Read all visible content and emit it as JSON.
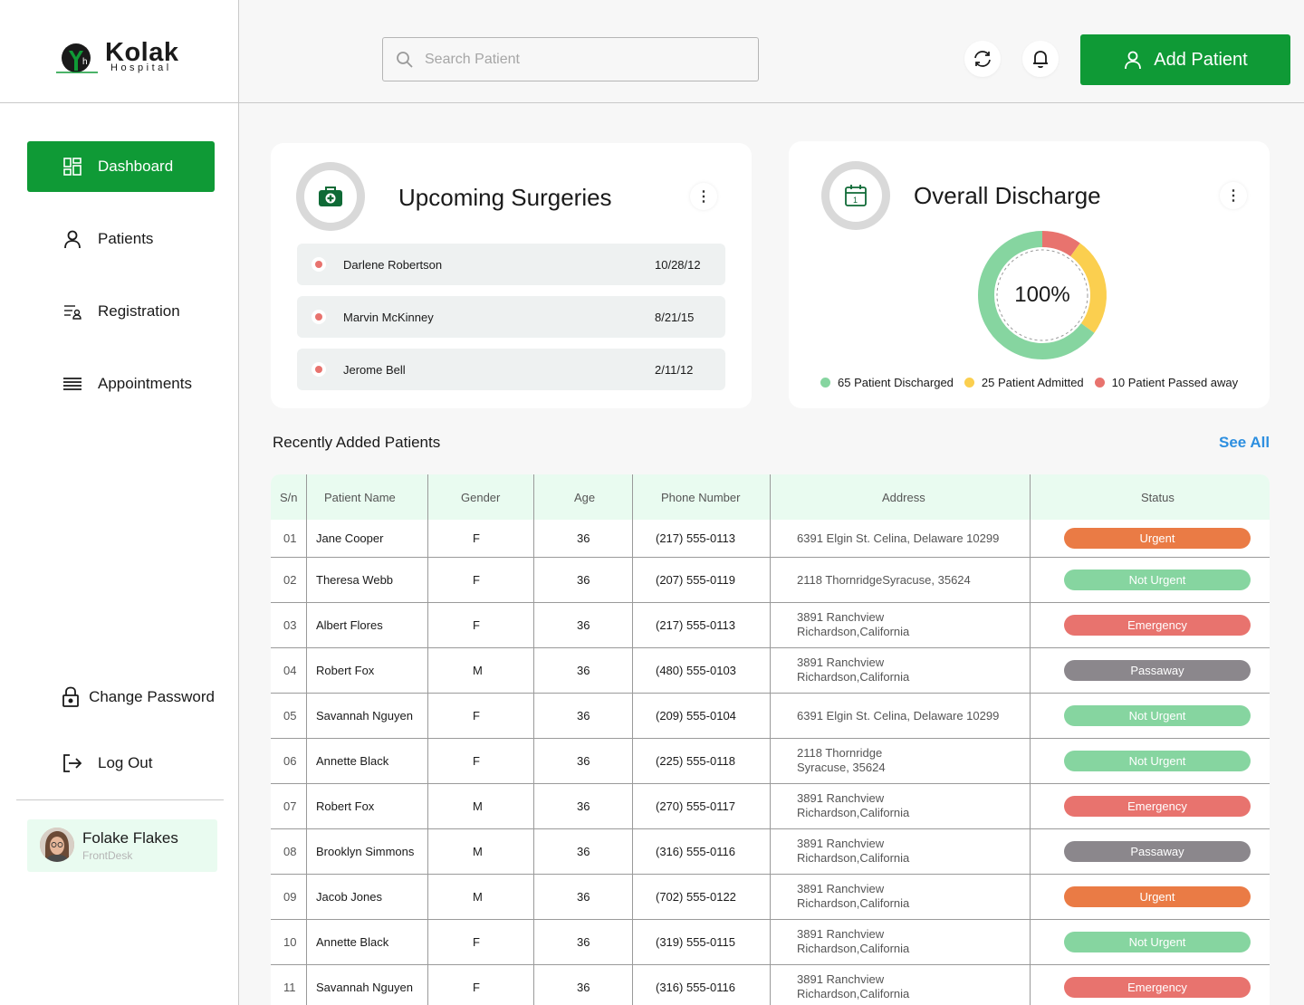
{
  "brand": {
    "name": "Kolak",
    "subtitle": "Hospital"
  },
  "header": {
    "search_placeholder": "Search Patient",
    "add_patient_label": "Add Patient"
  },
  "sidebar": {
    "items": [
      {
        "label": "Dashboard",
        "active": true
      },
      {
        "label": "Patients"
      },
      {
        "label": "Registration"
      },
      {
        "label": "Appointments"
      }
    ],
    "bottom_items": [
      {
        "label": "Change Password"
      },
      {
        "label": "Log Out"
      }
    ],
    "user": {
      "name": "Folake Flakes",
      "role": "FrontDesk"
    }
  },
  "surgeries": {
    "title": "Upcoming Surgeries",
    "items": [
      {
        "name": "Darlene Robertson",
        "date": "10/28/12"
      },
      {
        "name": "Marvin McKinney",
        "date": "8/21/15"
      },
      {
        "name": "Jerome Bell",
        "date": "2/11/12"
      }
    ]
  },
  "discharge": {
    "title": "Overall Discharge",
    "center_label": "100%",
    "segments": [
      {
        "label": "65 Patient Discharged",
        "value": 65,
        "color": "#86d5a0"
      },
      {
        "label": "25 Patient Admitted",
        "value": 25,
        "color": "#fbcf4f"
      },
      {
        "label": "10 Patient Passed away",
        "value": 10,
        "color": "#e8736e"
      }
    ]
  },
  "recent": {
    "title": "Recently Added Patients",
    "see_all": "See All",
    "columns": [
      "S/n",
      "Patient Name",
      "Gender",
      "Age",
      "Phone Number",
      "Address",
      "Status"
    ],
    "rows": [
      {
        "sn": "01",
        "name": "Jane Cooper",
        "gender": "F",
        "age": "36",
        "phone": "(217) 555-0113",
        "address": [
          "6391 Elgin St. Celina, Delaware 10299"
        ],
        "status": "Urgent"
      },
      {
        "sn": "02",
        "name": "Theresa Webb",
        "gender": "F",
        "age": "36",
        "phone": "(207) 555-0119",
        "address": [
          "2118 ThornridgeSyracuse,  35624"
        ],
        "status": "Not Urgent"
      },
      {
        "sn": "03",
        "name": "Albert Flores",
        "gender": "F",
        "age": "36",
        "phone": "(217) 555-0113",
        "address": [
          "3891 Ranchview",
          "Richardson,California"
        ],
        "status": "Emergency"
      },
      {
        "sn": "04",
        "name": "Robert Fox",
        "gender": "M",
        "age": "36",
        "phone": "(480) 555-0103",
        "address": [
          "3891 Ranchview",
          "Richardson,California"
        ],
        "status": "Passaway"
      },
      {
        "sn": "05",
        "name": "Savannah Nguyen",
        "gender": "F",
        "age": "36",
        "phone": "(209) 555-0104",
        "address": [
          "6391 Elgin St. Celina, Delaware 10299"
        ],
        "status": "Not Urgent"
      },
      {
        "sn": "06",
        "name": "Annette Black",
        "gender": "F",
        "age": "36",
        "phone": "(225) 555-0118",
        "address": [
          "2118 Thornridge",
          "Syracuse,  35624"
        ],
        "status": "Not Urgent"
      },
      {
        "sn": "07",
        "name": "Robert Fox",
        "gender": "M",
        "age": "36",
        "phone": "(270) 555-0117",
        "address": [
          "3891 Ranchview",
          "Richardson,California"
        ],
        "status": "Emergency"
      },
      {
        "sn": "08",
        "name": "Brooklyn Simmons",
        "gender": "M",
        "age": "36",
        "phone": "(316) 555-0116",
        "address": [
          "3891 Ranchview",
          "Richardson,California"
        ],
        "status": "Passaway"
      },
      {
        "sn": "09",
        "name": "Jacob Jones",
        "gender": "M",
        "age": "36",
        "phone": "(702) 555-0122",
        "address": [
          "3891 Ranchview",
          "Richardson,California"
        ],
        "status": "Urgent"
      },
      {
        "sn": "10",
        "name": "Annette Black",
        "gender": "F",
        "age": "36",
        "phone": "(319) 555-0115",
        "address": [
          "3891 Ranchview",
          "Richardson,California"
        ],
        "status": "Not Urgent"
      },
      {
        "sn": "11",
        "name": "Savannah Nguyen",
        "gender": "F",
        "age": "36",
        "phone": "(316) 555-0116",
        "address": [
          "3891 Ranchview",
          "Richardson,California"
        ],
        "status": "Emergency"
      }
    ]
  },
  "status_colors": {
    "Urgent": "#ea7b45",
    "Not Urgent": "#86d5a0",
    "Emergency": "#e8736e",
    "Passaway": "#8b878c"
  },
  "colors": {
    "primary": "#0f9a36",
    "link": "#2d8fe0",
    "header_bg": "#e9fbf0"
  }
}
